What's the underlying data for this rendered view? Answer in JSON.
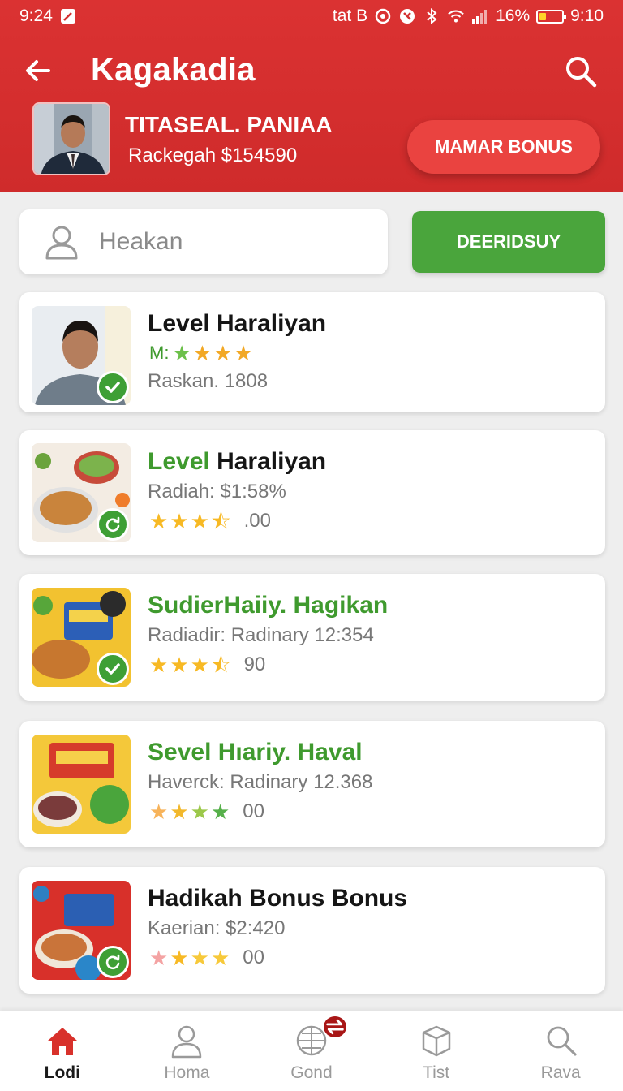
{
  "status_bar": {
    "time": "9:24",
    "carrier": "tat B",
    "battery_percent": "16%",
    "clock": "9:10",
    "battery_level": 0.16
  },
  "app_bar": {
    "title": "Kagakadia",
    "back_icon": "arrow-left-icon",
    "search_icon": "search-icon"
  },
  "profile": {
    "name": "TITASEAL. PANIAA",
    "balance": "Rackegah $154590",
    "bonus_button": "MAMAR BONUS"
  },
  "search": {
    "placeholder": "Heakan",
    "submit_label": "DEERIDSUY"
  },
  "colors": {
    "header_red": "#d32f2f",
    "bonus_red": "#ea4340",
    "accent_green": "#4aa53c",
    "star_yellow": "#f7b924"
  },
  "items": [
    {
      "title": "Level Haraliyan",
      "title_highlight": "",
      "rating_prefix": "M:",
      "detail": "Raskan. 1808",
      "rating": 4,
      "rating_value": "",
      "badge": "check-icon"
    },
    {
      "title": "Haraliyan",
      "title_highlight": "Level ",
      "detail": "Radiah: $1:58%",
      "rating": 3.5,
      "rating_value": ".00",
      "badge": "refresh-icon"
    },
    {
      "title": "",
      "title_highlight": "SudierHaiiy. Hagikan",
      "detail": "Radiadir: Radinary 12:354",
      "rating": 3.5,
      "rating_value": "90",
      "badge": "check-icon"
    },
    {
      "title": "",
      "title_highlight": "Sevel Hıariy. Haval",
      "detail": "Haverck: Radinary 12.368",
      "rating": 4,
      "rating_value": "00",
      "badge": ""
    },
    {
      "title": "Hadikah Bonus Bonus",
      "title_highlight": "",
      "detail": "Kaerian: $2:420",
      "rating": 4,
      "rating_value": "00",
      "badge": "refresh-icon"
    }
  ],
  "bottom_nav": [
    {
      "label": "Lodi",
      "icon": "home-icon",
      "active": true
    },
    {
      "label": "Homa",
      "icon": "person-icon",
      "active": false
    },
    {
      "label": "Gond",
      "icon": "grid-globe-icon",
      "active": false
    },
    {
      "label": "Tist",
      "icon": "box-icon",
      "active": false
    },
    {
      "label": "Rava",
      "icon": "search-icon",
      "active": false
    }
  ]
}
